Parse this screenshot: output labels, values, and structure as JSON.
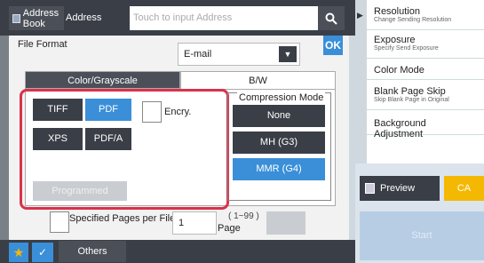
{
  "header": {
    "address_book_label": "Address Book",
    "address_label": "Address",
    "address_placeholder": "Touch to input Address"
  },
  "file_format": {
    "label": "File Format",
    "selected": "E-mail",
    "ok_label": "OK"
  },
  "tabs": [
    {
      "label": "Color/Grayscale",
      "active": false
    },
    {
      "label": "B/W",
      "active": true
    }
  ],
  "formats": {
    "tiff": "TIFF",
    "pdf": "PDF",
    "xps": "XPS",
    "pdfa": "PDF/A",
    "selected": "PDF",
    "encry_label": "Encry.",
    "programmed_label": "Programmed"
  },
  "compression": {
    "title": "Compression Mode",
    "none": "None",
    "mh": "MH (G3)",
    "mmr": "MMR (G4)",
    "selected": "MMR (G4)"
  },
  "pages": {
    "checkbox_label": "Specified Pages per File",
    "value": "1",
    "range": "( 1~99 )",
    "unit": "Page"
  },
  "bottom": {
    "others_label": "Others"
  },
  "side_menu": [
    {
      "title": "Resolution",
      "subtitle": "Change Sending Resolution"
    },
    {
      "title": "Exposure",
      "subtitle": "Specify Send Exposure"
    },
    {
      "title": "Color Mode",
      "subtitle": ""
    },
    {
      "title": "Blank Page Skip",
      "subtitle": "Skip Blank Page in Original"
    },
    {
      "title": "Background Adjustment",
      "subtitle": ""
    }
  ],
  "actions": {
    "preview": "Preview",
    "ca": "CA",
    "start": "Start"
  }
}
